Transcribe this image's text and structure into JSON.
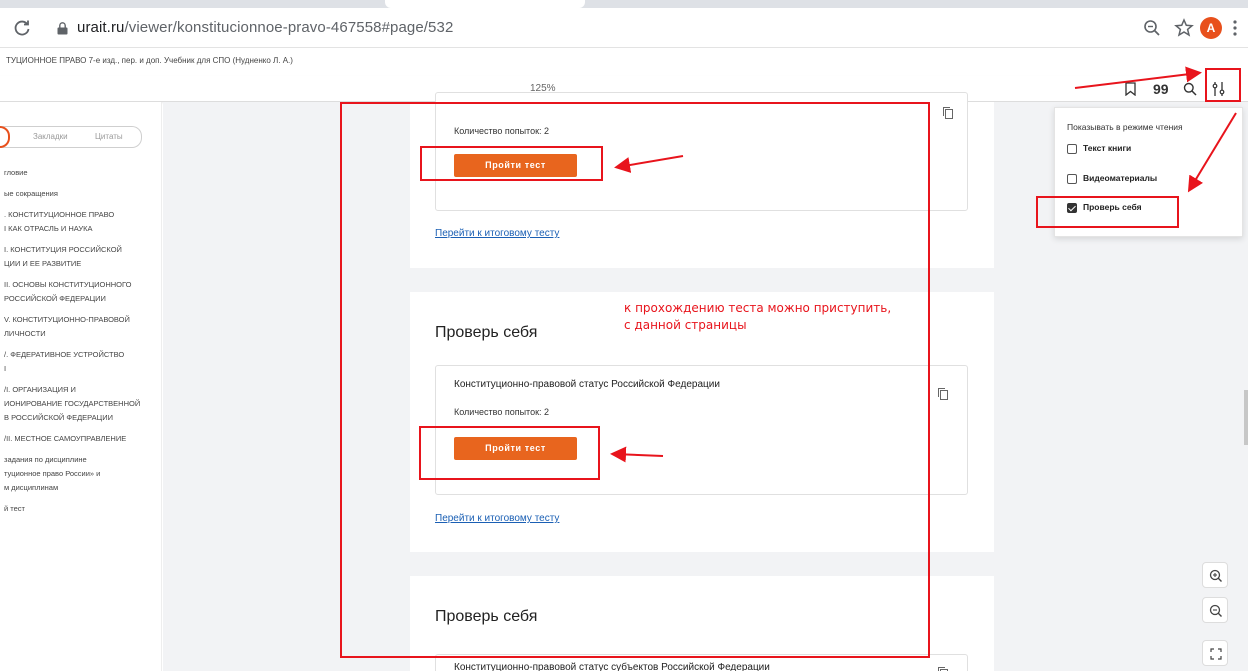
{
  "browser": {
    "url_host": "urait.ru",
    "url_path": "/viewer/konstitucionnoe-pravo-467558#page/532",
    "avatar_letter": "A"
  },
  "reader": {
    "book_title": "ТУЦИОННОЕ ПРАВО 7-е изд., пер. и доп. Учебник для СПО (Нудненко Л. А.)",
    "zoom_level": "125%",
    "quote_icon_glyph": "99"
  },
  "sidebar": {
    "tabs": [
      "Закладки",
      "Цитаты"
    ],
    "toc": [
      [
        "гловие"
      ],
      [
        "ые сокращения"
      ],
      [
        ". КОНСТИТУЦИОННОЕ ПРАВО",
        "I КАК ОТРАСЛЬ И НАУКА"
      ],
      [
        "I. КОНСТИТУЦИЯ РОССИЙСКОЙ",
        "ЦИИ И ЕЕ РАЗВИТИЕ"
      ],
      [
        "II. ОСНОВЫ КОНСТИТУЦИОННОГО",
        "РОССИЙСКОЙ ФЕДЕРАЦИИ"
      ],
      [
        "V. КОНСТИТУЦИОННО-ПРАВОВОЙ",
        "ЛИЧНОСТИ"
      ],
      [
        "/. ФЕДЕРАТИВНОЕ УСТРОЙСТВО",
        "I"
      ],
      [
        "/I. ОРГАНИЗАЦИЯ И",
        "ИОНИРОВАНИЕ ГОСУДАРСТВЕННОЙ",
        "В РОССИЙСКОЙ ФЕДЕРАЦИИ"
      ],
      [
        "/II. МЕСТНОЕ САМОУПРАВЛЕНИЕ"
      ],
      [
        "задания по дисциплине",
        "туционное право России» и",
        "м дисциплинам"
      ],
      [
        "й тест"
      ]
    ]
  },
  "content": {
    "attempts_label": "Количество попыток:",
    "attempts_value": "2",
    "test_button": "Пройти тест",
    "final_link": "Перейти к итоговому тесту",
    "section_heading": "Проверь себя",
    "card2_title": "Конституционно-правовой статус Российской Федерации",
    "card3_title": "Конституционно-правовой статус субъектов Российской Федерации"
  },
  "dropdown": {
    "title": "Показывать в режиме чтения",
    "options": [
      {
        "label": "Текст книги",
        "checked": false
      },
      {
        "label": "Видеоматериалы",
        "checked": false
      },
      {
        "label": "Проверь себя",
        "checked": true
      }
    ]
  },
  "annotation": {
    "line1": "к прохождению теста можно приступить,",
    "line2": "с данной страницы",
    "color": "#e8141c"
  },
  "colors": {
    "accent": "#e8651e",
    "link": "#1a5fb4"
  }
}
